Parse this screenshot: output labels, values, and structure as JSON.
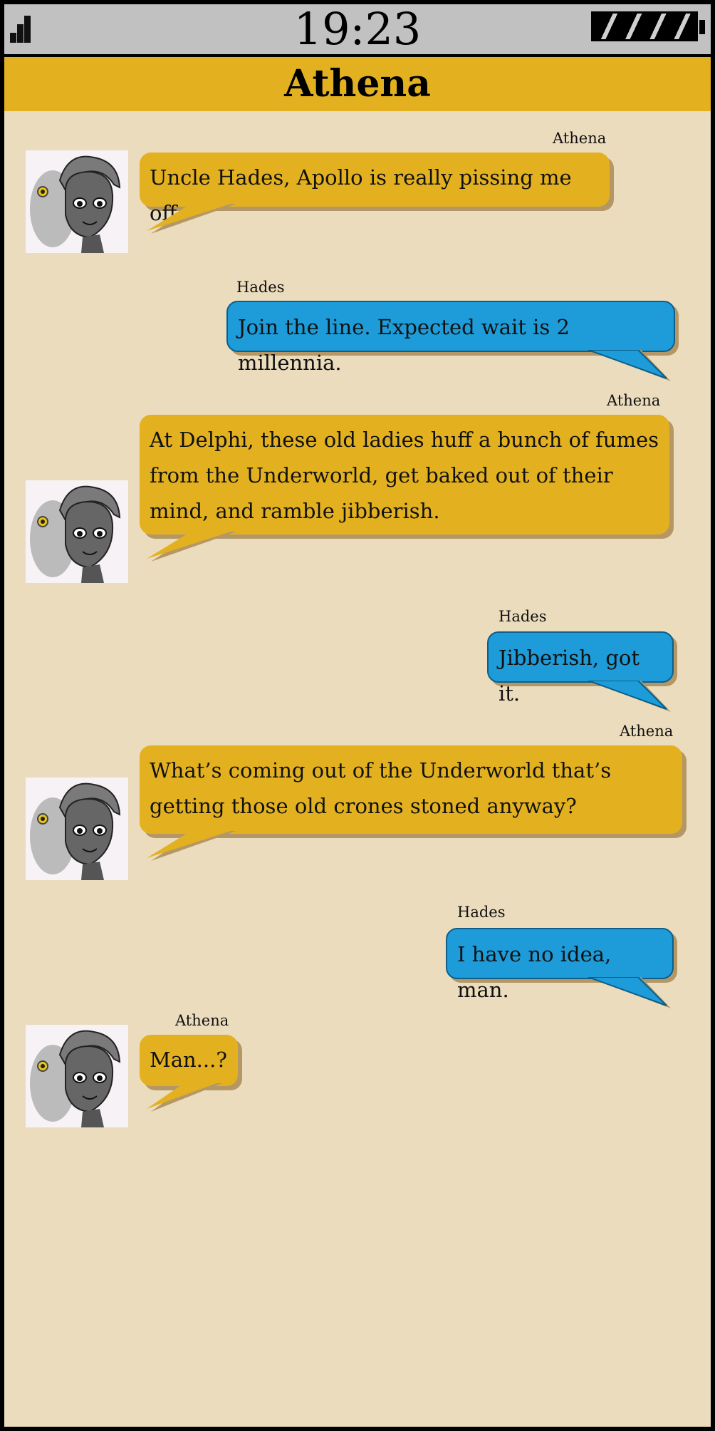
{
  "status_bar": {
    "time": "19:23",
    "icons": [
      "signal-icon",
      "battery-icon"
    ]
  },
  "header": {
    "title": "Athena"
  },
  "colors": {
    "athena_bubble": "#e3b120",
    "hades_bubble": "#1d9cd9",
    "background": "#ebdcbd",
    "status_bar": "#c1c1c1"
  },
  "messages": [
    {
      "sender": "Athena",
      "text": "Uncle Hades, Apollo is really pissing me off."
    },
    {
      "sender": "Hades",
      "text": "Join the line. Expected wait is 2 millennia."
    },
    {
      "sender": "Athena",
      "text": "At Delphi, these old ladies huff a bunch of fumes from the Underworld, get baked out of their mind, and ramble jibberish."
    },
    {
      "sender": "Hades",
      "text": "Jibberish, got it."
    },
    {
      "sender": "Athena",
      "text": "What’s coming out of the Underworld that’s getting those old crones stoned anyway?"
    },
    {
      "sender": "Hades",
      "text": "I have no idea, man."
    },
    {
      "sender": "Athena",
      "text": "Man...?"
    }
  ]
}
